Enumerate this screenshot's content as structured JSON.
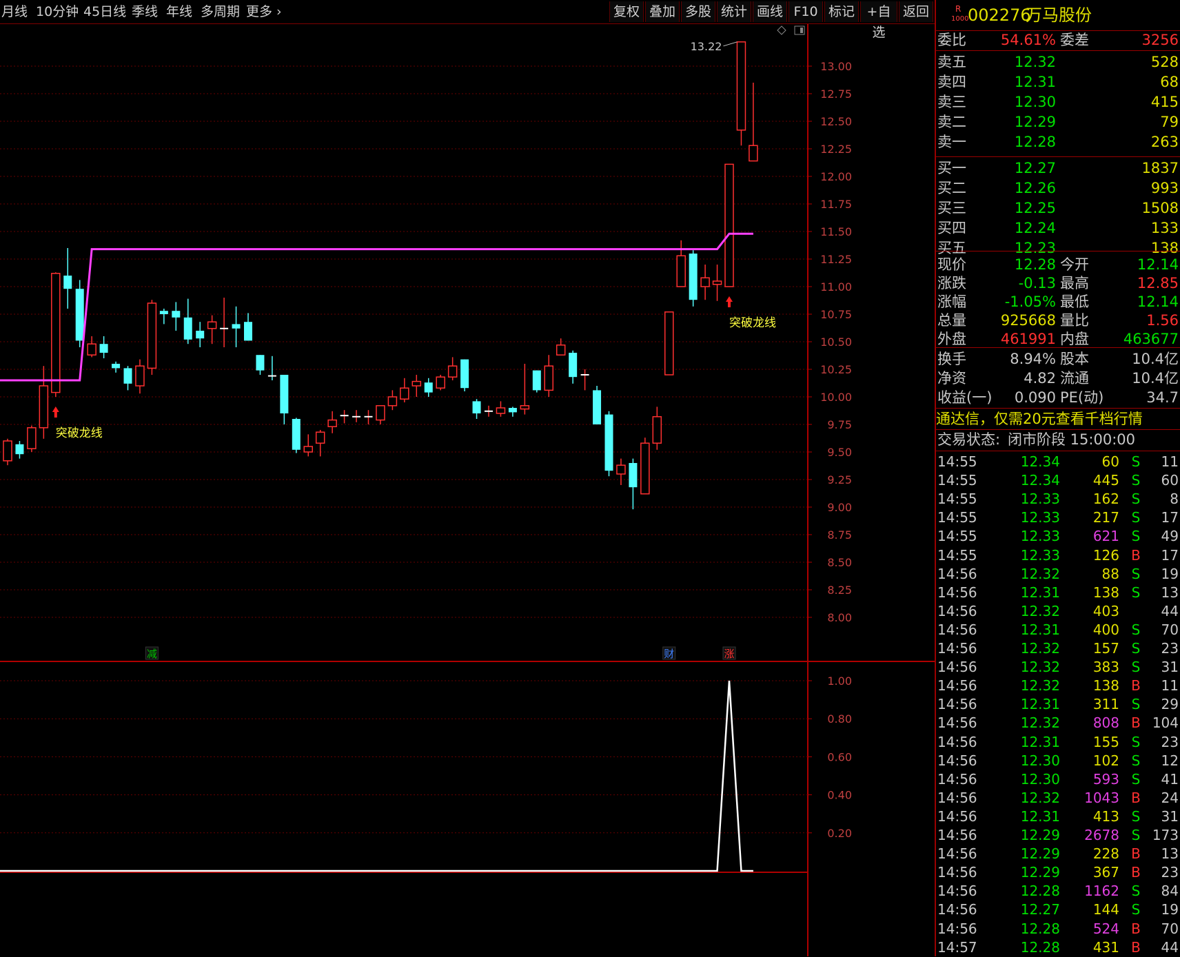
{
  "toolbar": {
    "left_items": [
      "月线",
      "10分钟",
      "45日线",
      "季线",
      "年线",
      "多周期",
      "更多"
    ],
    "right_items": [
      "复权",
      "叠加",
      "多股",
      "统计",
      "画线",
      "F10",
      "标记",
      "+自选",
      "返回"
    ]
  },
  "stock": {
    "badge_top": "R",
    "badge_bottom": "1000",
    "code": "002276",
    "name": "万马股份"
  },
  "quote": {
    "weibi_label": "委比",
    "weibi": "54.61%",
    "weicha_label": "委差",
    "weicha": "3256",
    "sell": [
      {
        "label": "卖五",
        "price": "12.32",
        "vol": "528"
      },
      {
        "label": "卖四",
        "price": "12.31",
        "vol": "68"
      },
      {
        "label": "卖三",
        "price": "12.30",
        "vol": "415"
      },
      {
        "label": "卖二",
        "price": "12.29",
        "vol": "79"
      },
      {
        "label": "卖一",
        "price": "12.28",
        "vol": "263"
      }
    ],
    "buy": [
      {
        "label": "买一",
        "price": "12.27",
        "vol": "1837"
      },
      {
        "label": "买二",
        "price": "12.26",
        "vol": "993"
      },
      {
        "label": "买三",
        "price": "12.25",
        "vol": "1508"
      },
      {
        "label": "买四",
        "price": "12.24",
        "vol": "133"
      },
      {
        "label": "买五",
        "price": "12.23",
        "vol": "138"
      }
    ],
    "stats": [
      {
        "l1": "现价",
        "v1": "12.28",
        "c1": "#00e000",
        "l2": "今开",
        "v2": "12.14",
        "c2": "#00e000"
      },
      {
        "l1": "涨跌",
        "v1": "-0.13",
        "c1": "#00e000",
        "l2": "最高",
        "v2": "12.85",
        "c2": "#ff3030"
      },
      {
        "l1": "涨幅",
        "v1": "-1.05%",
        "c1": "#00e000",
        "l2": "最低",
        "v2": "12.14",
        "c2": "#00e000"
      },
      {
        "l1": "总量",
        "v1": "925668",
        "c1": "#e0e000",
        "l2": "量比",
        "v2": "1.56",
        "c2": "#ff3030"
      },
      {
        "l1": "外盘",
        "v1": "461991",
        "c1": "#ff3030",
        "l2": "内盘",
        "v2": "463677",
        "c2": "#00e000"
      }
    ],
    "stats2": [
      {
        "l1": "换手",
        "v1": "8.94%",
        "l2": "股本",
        "v2": "10.4亿"
      },
      {
        "l1": "净资",
        "v1": "4.82",
        "l2": "流通",
        "v2": "10.4亿"
      },
      {
        "l1": "收益(一)",
        "v1": "0.090",
        "l2": "PE(动)",
        "v2": "34.7"
      }
    ],
    "notice": "通达信，仅需20元查看千档行情",
    "status_label": "交易状态:",
    "status_value": "闭市阶段 15:00:00"
  },
  "ticks": [
    [
      "14:55",
      "12.34",
      "60",
      "S",
      "11"
    ],
    [
      "14:55",
      "12.34",
      "445",
      "S",
      "60"
    ],
    [
      "14:55",
      "12.33",
      "162",
      "S",
      "8"
    ],
    [
      "14:55",
      "12.33",
      "217",
      "S",
      "17"
    ],
    [
      "14:55",
      "12.33",
      "621",
      "S",
      "49"
    ],
    [
      "14:55",
      "12.33",
      "126",
      "B",
      "17"
    ],
    [
      "14:56",
      "12.32",
      "88",
      "S",
      "19"
    ],
    [
      "14:56",
      "12.31",
      "138",
      "S",
      "13"
    ],
    [
      "14:56",
      "12.32",
      "403",
      "",
      "44"
    ],
    [
      "14:56",
      "12.31",
      "400",
      "S",
      "70"
    ],
    [
      "14:56",
      "12.32",
      "157",
      "S",
      "23"
    ],
    [
      "14:56",
      "12.32",
      "383",
      "S",
      "31"
    ],
    [
      "14:56",
      "12.32",
      "138",
      "B",
      "11"
    ],
    [
      "14:56",
      "12.31",
      "311",
      "S",
      "29"
    ],
    [
      "14:56",
      "12.32",
      "808",
      "B",
      "104"
    ],
    [
      "14:56",
      "12.31",
      "155",
      "S",
      "23"
    ],
    [
      "14:56",
      "12.30",
      "102",
      "S",
      "12"
    ],
    [
      "14:56",
      "12.30",
      "593",
      "S",
      "41"
    ],
    [
      "14:56",
      "12.32",
      "1043",
      "B",
      "24"
    ],
    [
      "14:56",
      "12.31",
      "413",
      "S",
      "31"
    ],
    [
      "14:56",
      "12.29",
      "2678",
      "S",
      "173"
    ],
    [
      "14:56",
      "12.29",
      "228",
      "B",
      "13"
    ],
    [
      "14:56",
      "12.29",
      "367",
      "B",
      "23"
    ],
    [
      "14:56",
      "12.28",
      "1162",
      "S",
      "84"
    ],
    [
      "14:56",
      "12.27",
      "144",
      "S",
      "19"
    ],
    [
      "14:56",
      "12.28",
      "524",
      "B",
      "70"
    ],
    [
      "14:57",
      "12.28",
      "431",
      "B",
      "44"
    ]
  ],
  "chart_data": [
    {
      "type": "candlestick",
      "ylim": [
        7.75,
        13.3
      ],
      "yticks": [
        "13.00",
        "12.75",
        "12.50",
        "12.25",
        "12.00",
        "11.75",
        "11.50",
        "11.25",
        "11.00",
        "10.75",
        "10.50",
        "10.25",
        "10.00",
        "9.75",
        "9.50",
        "9.25",
        "9.00",
        "8.75",
        "8.50",
        "8.25",
        "8.00"
      ],
      "max_label": "13.22",
      "candles": [
        [
          9.42,
          9.6,
          9.38,
          9.62
        ],
        [
          9.57,
          9.48,
          9.44,
          9.6
        ],
        [
          9.53,
          9.72,
          9.5,
          9.74
        ],
        [
          9.72,
          10.1,
          9.62,
          10.28
        ],
        [
          10.04,
          11.12,
          10.0,
          11.13
        ],
        [
          11.1,
          10.98,
          10.8,
          11.35
        ],
        [
          10.98,
          10.51,
          10.45,
          11.06
        ],
        [
          10.38,
          10.48,
          10.36,
          10.55
        ],
        [
          10.48,
          10.4,
          10.35,
          10.55
        ],
        [
          10.3,
          10.26,
          10.22,
          10.32
        ],
        [
          10.26,
          10.12,
          10.06,
          10.28
        ],
        [
          10.1,
          10.28,
          10.03,
          10.34
        ],
        [
          10.26,
          10.85,
          10.2,
          10.88
        ],
        [
          10.78,
          10.75,
          10.66,
          10.8
        ],
        [
          10.78,
          10.72,
          10.6,
          10.86
        ],
        [
          10.72,
          10.52,
          10.48,
          10.89
        ],
        [
          10.6,
          10.53,
          10.45,
          10.68
        ],
        [
          10.62,
          10.68,
          10.48,
          10.74
        ],
        [
          10.62,
          10.62,
          10.45,
          10.9
        ],
        [
          10.66,
          10.62,
          10.45,
          10.82
        ],
        [
          10.68,
          10.51,
          10.51,
          10.76
        ],
        [
          10.38,
          10.24,
          10.2,
          10.38
        ],
        [
          10.2,
          10.19,
          10.15,
          10.37
        ],
        [
          10.2,
          9.85,
          9.75,
          10.2
        ],
        [
          9.8,
          9.52,
          9.49,
          9.81
        ],
        [
          9.5,
          9.55,
          9.46,
          9.66
        ],
        [
          9.58,
          9.68,
          9.46,
          9.7
        ],
        [
          9.73,
          9.79,
          9.67,
          9.87
        ],
        [
          9.83,
          9.83,
          9.76,
          9.88
        ],
        [
          9.82,
          9.82,
          9.77,
          9.88
        ],
        [
          9.82,
          9.82,
          9.75,
          9.88
        ],
        [
          9.79,
          9.92,
          9.75,
          9.92
        ],
        [
          9.92,
          10.0,
          9.88,
          10.06
        ],
        [
          9.98,
          10.08,
          9.95,
          10.17
        ],
        [
          10.1,
          10.14,
          10.0,
          10.2
        ],
        [
          10.13,
          10.04,
          10.0,
          10.17
        ],
        [
          10.08,
          10.18,
          10.06,
          10.2
        ],
        [
          10.18,
          10.28,
          10.15,
          10.36
        ],
        [
          10.34,
          10.08,
          10.05,
          10.34
        ],
        [
          9.96,
          9.85,
          9.8,
          9.98
        ],
        [
          9.87,
          9.87,
          9.82,
          9.92
        ],
        [
          9.85,
          9.9,
          9.82,
          9.96
        ],
        [
          9.9,
          9.86,
          9.82,
          9.91
        ],
        [
          9.89,
          9.92,
          9.84,
          10.3
        ],
        [
          10.24,
          10.06,
          10.04,
          10.24
        ],
        [
          10.06,
          10.28,
          10.0,
          10.38
        ],
        [
          10.38,
          10.47,
          10.4,
          10.53
        ],
        [
          10.4,
          10.18,
          10.12,
          10.42
        ],
        [
          10.2,
          10.2,
          10.06,
          10.25
        ],
        [
          10.06,
          9.75,
          9.75,
          10.1
        ],
        [
          9.84,
          9.33,
          9.28,
          9.87
        ],
        [
          9.3,
          9.38,
          9.2,
          9.44
        ],
        [
          9.4,
          9.18,
          8.98,
          9.44
        ],
        [
          9.12,
          9.58,
          9.12,
          9.63
        ],
        [
          9.58,
          9.82,
          9.52,
          9.91
        ],
        [
          10.2,
          10.77,
          10.2,
          10.77
        ],
        [
          11.0,
          11.28,
          11.0,
          11.42
        ],
        [
          11.3,
          10.88,
          10.82,
          11.33
        ],
        [
          11.0,
          11.08,
          10.88,
          11.2
        ],
        [
          11.02,
          11.05,
          10.87,
          11.2
        ],
        [
          11.0,
          12.11,
          11.0,
          12.11
        ],
        [
          12.42,
          13.22,
          12.28,
          13.22
        ],
        [
          12.14,
          12.28,
          12.14,
          12.85
        ]
      ],
      "line": [
        [
          0,
          10.15
        ],
        [
          6,
          10.15
        ],
        [
          7,
          11.34
        ],
        [
          59,
          11.34
        ],
        [
          60,
          11.48
        ],
        [
          62,
          11.48
        ]
      ],
      "signals": [
        {
          "index": 4,
          "text": "突破龙线"
        },
        {
          "index": 60,
          "text": "突破龙线"
        }
      ],
      "markers": [
        {
          "index": 12,
          "text": "减"
        },
        {
          "index": 55,
          "text": "财"
        },
        {
          "index": 60,
          "text": "涨"
        }
      ]
    },
    {
      "type": "line",
      "ylim": [
        0,
        1.1
      ],
      "yticks": [
        "1.00",
        "0.80",
        "0.60",
        "0.40",
        "0.20"
      ],
      "values": [
        0,
        0,
        0,
        0,
        0,
        0,
        0,
        0,
        0,
        0,
        0,
        0,
        0,
        0,
        0,
        0,
        0,
        0,
        0,
        0,
        0,
        0,
        0,
        0,
        0,
        0,
        0,
        0,
        0,
        0,
        0,
        0,
        0,
        0,
        0,
        0,
        0,
        0,
        0,
        0,
        0,
        0,
        0,
        0,
        0,
        0,
        0,
        0,
        0,
        0,
        0,
        0,
        0,
        0,
        0,
        0,
        0,
        0,
        0,
        0,
        1,
        0,
        0
      ]
    }
  ]
}
